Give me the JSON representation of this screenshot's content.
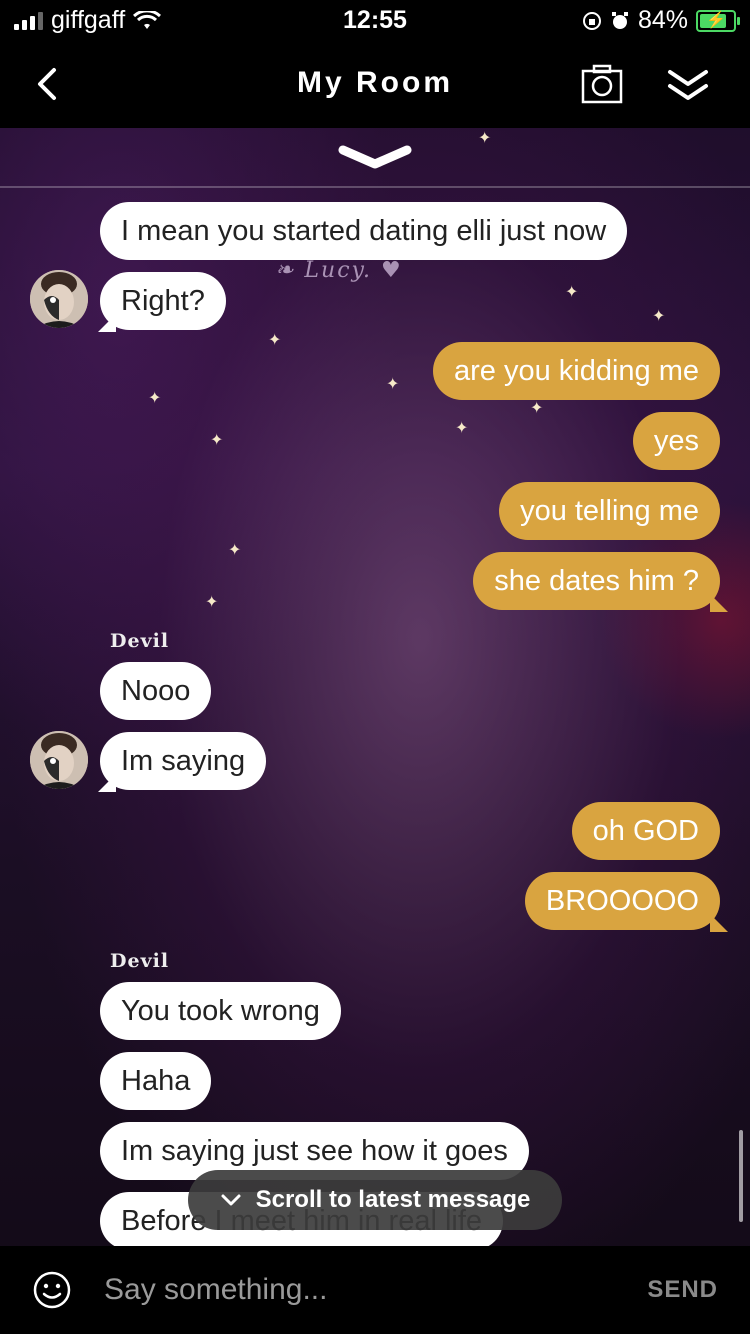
{
  "status_bar": {
    "carrier": "giffgaff",
    "time": "12:55",
    "battery": "84%"
  },
  "header": {
    "title": "My Room"
  },
  "watermark": "❧ Lucy. ♥",
  "messages": [
    {
      "text": "I mean you started dating elli just now",
      "side": "in"
    },
    {
      "text": "Right?",
      "side": "in"
    },
    {
      "text": "are you kidding me",
      "side": "out"
    },
    {
      "text": "yes",
      "side": "out"
    },
    {
      "text": "you telling me",
      "side": "out"
    },
    {
      "text": "she dates him ?",
      "side": "out"
    },
    {
      "text": "Nooo",
      "side": "in"
    },
    {
      "text": "Im saying",
      "side": "in"
    },
    {
      "text": "oh GOD",
      "side": "out"
    },
    {
      "text": "BROOOOO",
      "side": "out"
    },
    {
      "text": "You took wrong",
      "side": "in"
    },
    {
      "text": "Haha",
      "side": "in"
    },
    {
      "text": "Im saying just see how it goes",
      "side": "in"
    },
    {
      "text": "Before I meet him in real life",
      "side": "in"
    }
  ],
  "senders": [
    "Devil",
    "Devil"
  ],
  "scroll_pill": {
    "label": "Scroll to latest message"
  },
  "input": {
    "placeholder": "Say something...",
    "send_label": "SEND"
  },
  "colors": {
    "outgoing_bubble": "#d9a440",
    "incoming_bubble": "#ffffff",
    "bar_background": "#000000"
  }
}
